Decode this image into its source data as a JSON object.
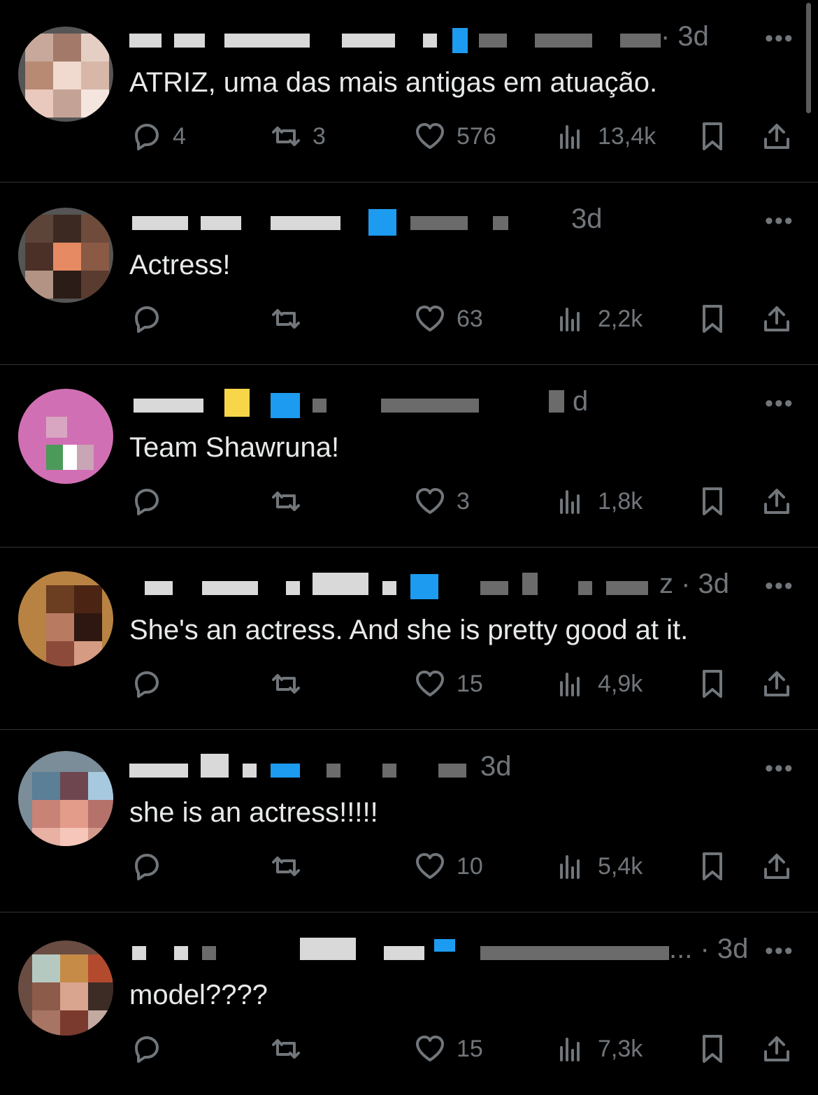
{
  "tweets": [
    {
      "time": "· 3d",
      "text": "ATRIZ, uma das mais antigas em atuação.",
      "replies": "4",
      "reposts": "3",
      "likes": "576",
      "views": "13,4k"
    },
    {
      "time": "3d",
      "text": "Actress!",
      "replies": "",
      "reposts": "",
      "likes": "63",
      "views": "2,2k"
    },
    {
      "time": "d",
      "text": "Team Shawruna!",
      "replies": "",
      "reposts": "",
      "likes": "3",
      "views": "1,8k"
    },
    {
      "time": "z · 3d",
      "text": "She's an actress. And she is pretty good at it.",
      "replies": "",
      "reposts": "",
      "likes": "15",
      "views": "4,9k"
    },
    {
      "time": "3d",
      "text": "she is an actress!!!!!",
      "replies": "",
      "reposts": "",
      "likes": "10",
      "views": "5,4k"
    },
    {
      "time": "... · 3d",
      "text": "model????",
      "replies": "",
      "reposts": "",
      "likes": "15",
      "views": "7,3k"
    }
  ],
  "more_label": "•••",
  "icons": [
    "reply-icon",
    "repost-icon",
    "like-icon",
    "views-icon",
    "bookmark-icon",
    "share-icon"
  ],
  "colors": {
    "background": "#000000",
    "text": "#e7e9ea",
    "muted": "#71767b",
    "verified": "#1d9bf0",
    "divider": "#2f3336"
  }
}
